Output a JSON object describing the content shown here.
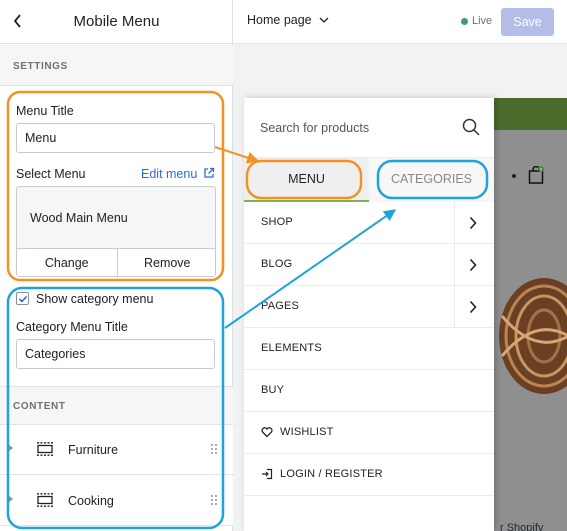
{
  "sidebar": {
    "title": "Mobile Menu",
    "back_icon": "back-chevron-icon",
    "settings_label": "SETTINGS",
    "menu_title_label": "Menu Title",
    "menu_title_value": "Menu",
    "select_menu_label": "Select Menu",
    "edit_menu_label": "Edit menu",
    "selected_menu_name": "Wood Main Menu",
    "change_label": "Change",
    "remove_label": "Remove",
    "show_category_label": "Show category menu",
    "show_category_checked": true,
    "category_title_label": "Category Menu Title",
    "category_title_value": "Categories",
    "content_label": "CONTENT",
    "content_items": [
      {
        "label": "Furniture"
      },
      {
        "label": "Cooking"
      }
    ]
  },
  "topbar": {
    "page_select": "Home page",
    "live_label": "Live",
    "live_color": "#35a36b",
    "save_label": "Save"
  },
  "drawer": {
    "search_placeholder": "Search for products",
    "tabs": [
      {
        "label": "MENU",
        "active": true
      },
      {
        "label": "CATEGORIES",
        "active": false
      }
    ],
    "items": [
      {
        "label": "SHOP",
        "has_children": true
      },
      {
        "label": "BLOG",
        "has_children": true
      },
      {
        "label": "PAGES",
        "has_children": true
      },
      {
        "label": "ELEMENTS",
        "has_children": false
      },
      {
        "label": "BUY",
        "has_children": false
      },
      {
        "label": "WISHLIST",
        "icon": "heart-icon"
      },
      {
        "label": "LOGIN / REGISTER",
        "icon": "login-icon"
      }
    ]
  },
  "preview": {
    "badge_count": "0",
    "footer_text": "r Shopify"
  },
  "annotation_colors": {
    "orange": "#f39224",
    "blue": "#1fa3dc"
  }
}
